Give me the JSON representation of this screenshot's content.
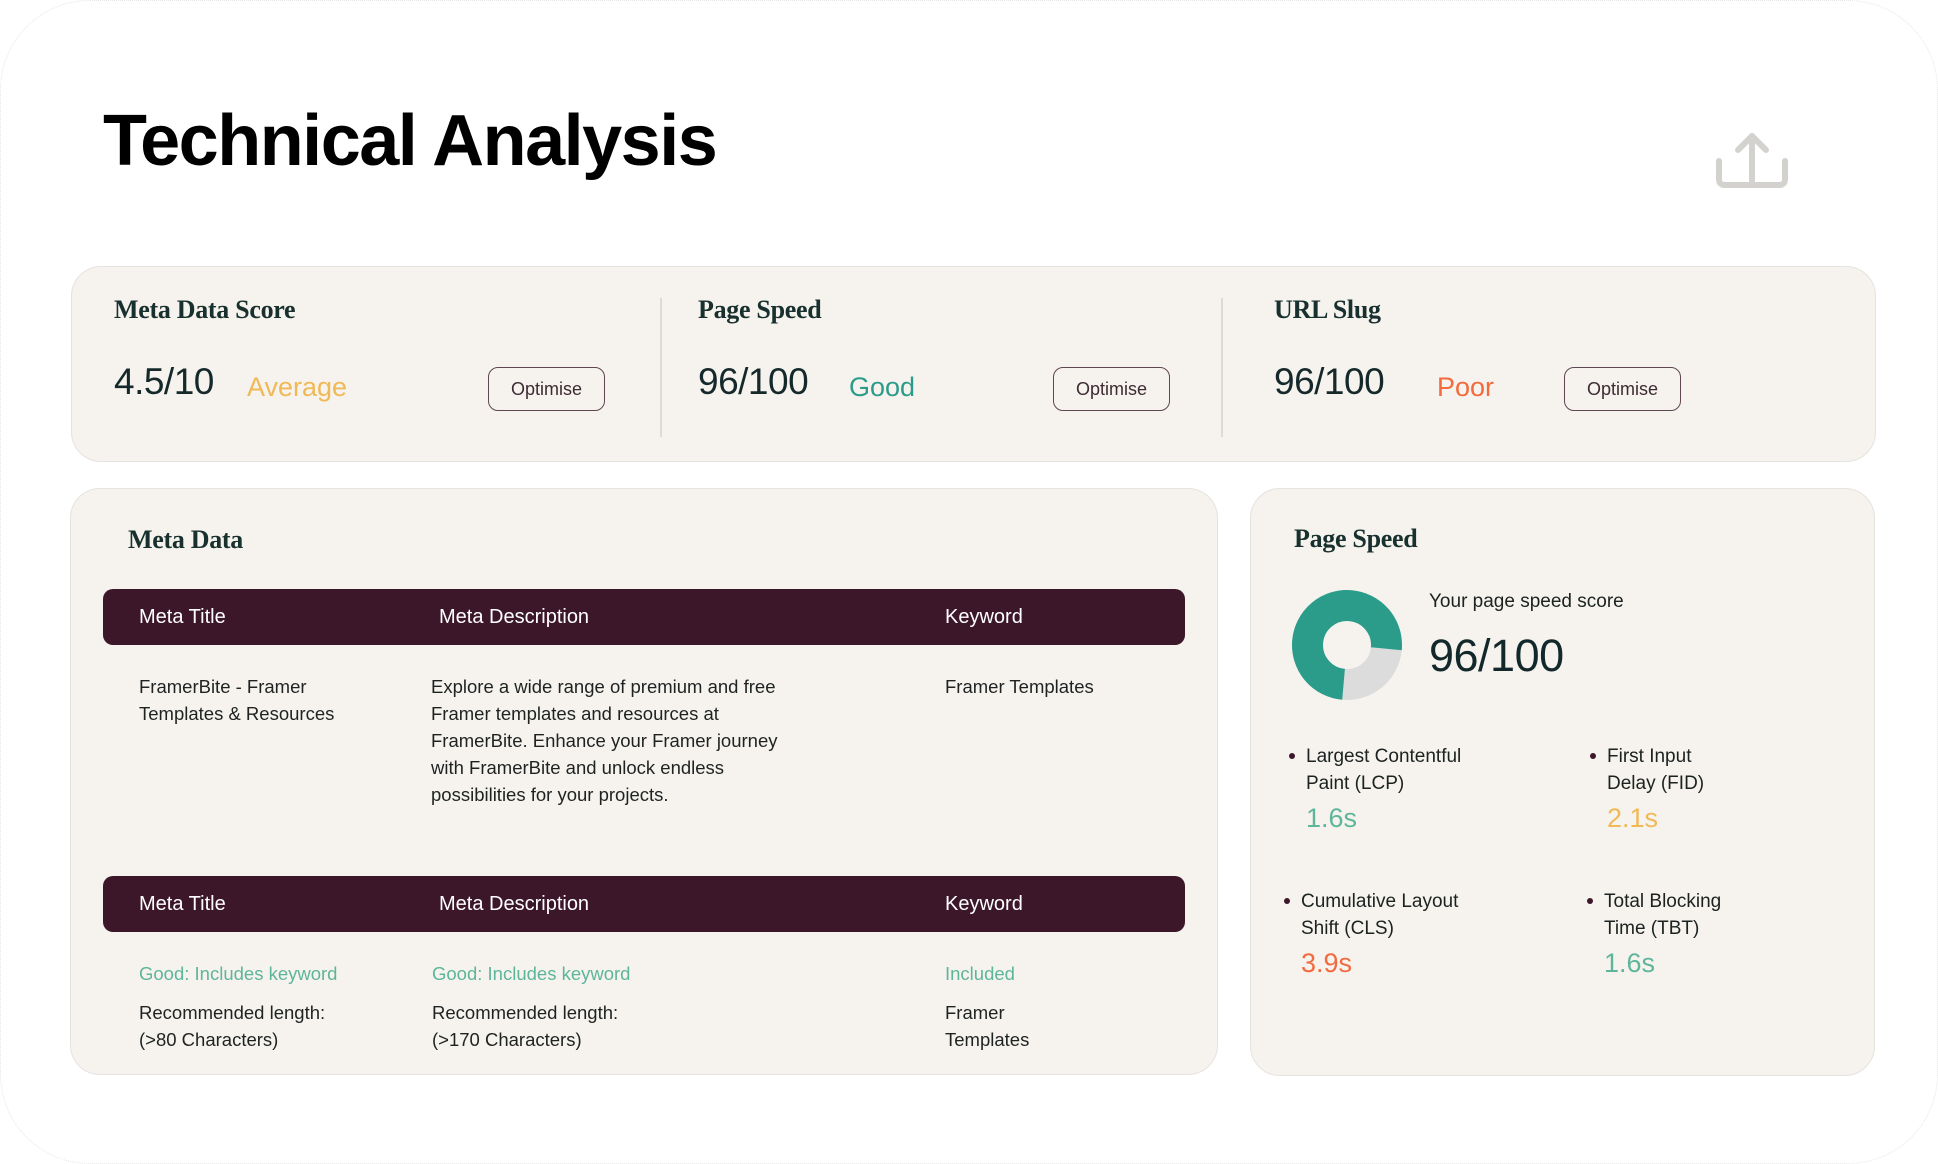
{
  "page": {
    "title": "Technical Analysis",
    "share_icon": "share-upload-icon"
  },
  "colors": {
    "good": "#2c9c8a",
    "average": "#f0b955",
    "poor": "#f26a3d",
    "header_bg": "#3c172a",
    "good_light": "#5db59b"
  },
  "scores": [
    {
      "title": "Meta Data Score",
      "value": "4.5/10",
      "status": "Average",
      "status_color": "#f0b955",
      "button": "Optimise"
    },
    {
      "title": "Page Speed",
      "value": "96/100",
      "status": "Good",
      "status_color": "#2c9c8a",
      "button": "Optimise"
    },
    {
      "title": "URL Slug",
      "value": "96/100",
      "status": "Poor",
      "status_color": "#f26a3d",
      "button": "Optimise"
    }
  ],
  "meta_data": {
    "title": "Meta Data",
    "columns": [
      "Meta Title",
      "Meta Description",
      "Keyword"
    ],
    "row": {
      "meta_title": "FramerBite - Framer Templates & Resources",
      "meta_description": "Explore a wide range of premium and free Framer templates and resources at FramerBite. Enhance your Framer journey with FramerBite and unlock endless possibilities for your projects.",
      "keyword": "Framer Templates"
    },
    "analysis_columns": [
      "Meta Title",
      "Meta Description",
      "Keyword"
    ],
    "analysis": {
      "meta_title_status": "Good: Includes keyword",
      "meta_title_rec": "Recommended length: (>80 Characters)",
      "meta_description_status": "Good: Includes keyword",
      "meta_description_rec": "Recommended length: (>170 Characters)",
      "keyword_status": "Included",
      "keyword_value": "Framer Templates"
    }
  },
  "page_speed": {
    "title": "Page Speed",
    "score_label": "Your page speed score",
    "score_value": "96/100",
    "donut_fraction": 0.75,
    "donut_colors": {
      "fill": "#2c9c8a",
      "rest": "#dcdcdc"
    },
    "metrics": [
      {
        "label": "Largest Contentful Paint (LCP)",
        "value": "1.6s",
        "color": "#5db59b"
      },
      {
        "label": "First Input Delay (FID)",
        "value": "2.1s",
        "color": "#f0b955"
      },
      {
        "label": "Cumulative Layout Shift (CLS)",
        "value": "3.9s",
        "color": "#f26a3d"
      },
      {
        "label": "Total Blocking Time (TBT)",
        "value": "1.6s",
        "color": "#5db59b"
      }
    ]
  }
}
